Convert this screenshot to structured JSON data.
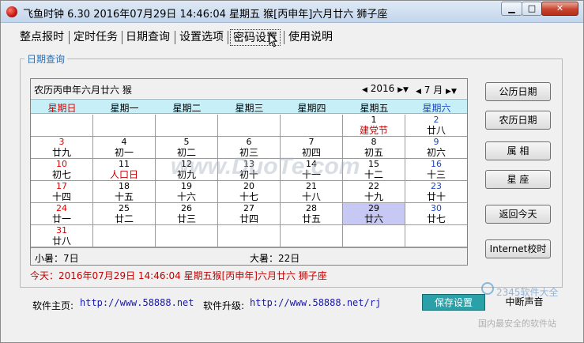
{
  "window": {
    "title": "飞鱼时钟 6.30 2016年07月29日 14:46:04 星期五 猴[丙申年]六月廿六 狮子座",
    "minimize": "▁",
    "maximize": "□",
    "close": "✕"
  },
  "tabs": [
    {
      "label": "整点报时"
    },
    {
      "label": "定时任务"
    },
    {
      "label": "日期查询"
    },
    {
      "label": "设置选项"
    },
    {
      "label": "密码设置"
    },
    {
      "label": "使用说明"
    }
  ],
  "group_title": "日期查询",
  "calendar": {
    "lunar_header": "农历丙申年六月廿六     猴",
    "year": "2016",
    "month": "7 月",
    "weekdays": [
      "星期日",
      "星期一",
      "星期二",
      "星期三",
      "星期四",
      "星期五",
      "星期六"
    ],
    "days": [
      {
        "d": "1",
        "l": "建党节"
      },
      {
        "d": "2",
        "l": "廿八"
      },
      {
        "d": "3",
        "l": "廿九"
      },
      {
        "d": "4",
        "l": "初一"
      },
      {
        "d": "5",
        "l": "初二"
      },
      {
        "d": "6",
        "l": "初三"
      },
      {
        "d": "7",
        "l": "初四"
      },
      {
        "d": "8",
        "l": "初五"
      },
      {
        "d": "9",
        "l": "初六"
      },
      {
        "d": "10",
        "l": "初七"
      },
      {
        "d": "11",
        "l": "人口日"
      },
      {
        "d": "12",
        "l": "初九"
      },
      {
        "d": "13",
        "l": "初十"
      },
      {
        "d": "14",
        "l": "十一"
      },
      {
        "d": "15",
        "l": "十二"
      },
      {
        "d": "16",
        "l": "十三"
      },
      {
        "d": "17",
        "l": "十四"
      },
      {
        "d": "18",
        "l": "十五"
      },
      {
        "d": "19",
        "l": "十六"
      },
      {
        "d": "20",
        "l": "十七"
      },
      {
        "d": "21",
        "l": "十八"
      },
      {
        "d": "22",
        "l": "十九"
      },
      {
        "d": "23",
        "l": "廿十"
      },
      {
        "d": "24",
        "l": "廿一"
      },
      {
        "d": "25",
        "l": "廿二"
      },
      {
        "d": "26",
        "l": "廿三"
      },
      {
        "d": "27",
        "l": "廿四"
      },
      {
        "d": "28",
        "l": "廿五"
      },
      {
        "d": "29",
        "l": "廿六"
      },
      {
        "d": "30",
        "l": "廿七"
      },
      {
        "d": "31",
        "l": "廿八"
      }
    ],
    "solar_term_1": "小暑：7日",
    "solar_term_2": "大暑：22日"
  },
  "today_line": "今天：2016年07月29日 14:46:04 星期五猴[丙申年]六月廿六 狮子座",
  "side_buttons": [
    "公历日期",
    "农历日期",
    "属  相",
    "星  座",
    "返回今天",
    "Internet校时"
  ],
  "footer": {
    "homepage_label": "软件主页:",
    "homepage_url": "http://www.58888.net",
    "upgrade_label": "软件升级:",
    "upgrade_url": "http://www.58888.net/rj",
    "save_button": "保存设置",
    "mute_button": "中断声音"
  },
  "watermarks": {
    "center": "www.DuoTe.com",
    "brand": "2345软件大全",
    "sub": "国内最安全的软件站"
  },
  "colors": {
    "holiday_red": "#e00000",
    "sunday_red": "#e00000",
    "saturday_blue": "#1f47c8",
    "today_highlight": "#c8c8f4",
    "weekday_header_bg": "#c7eff7",
    "group_title_blue": "#2b6fb5",
    "today_line_red": "#c40000",
    "save_button_teal": "#2aa0a8"
  }
}
